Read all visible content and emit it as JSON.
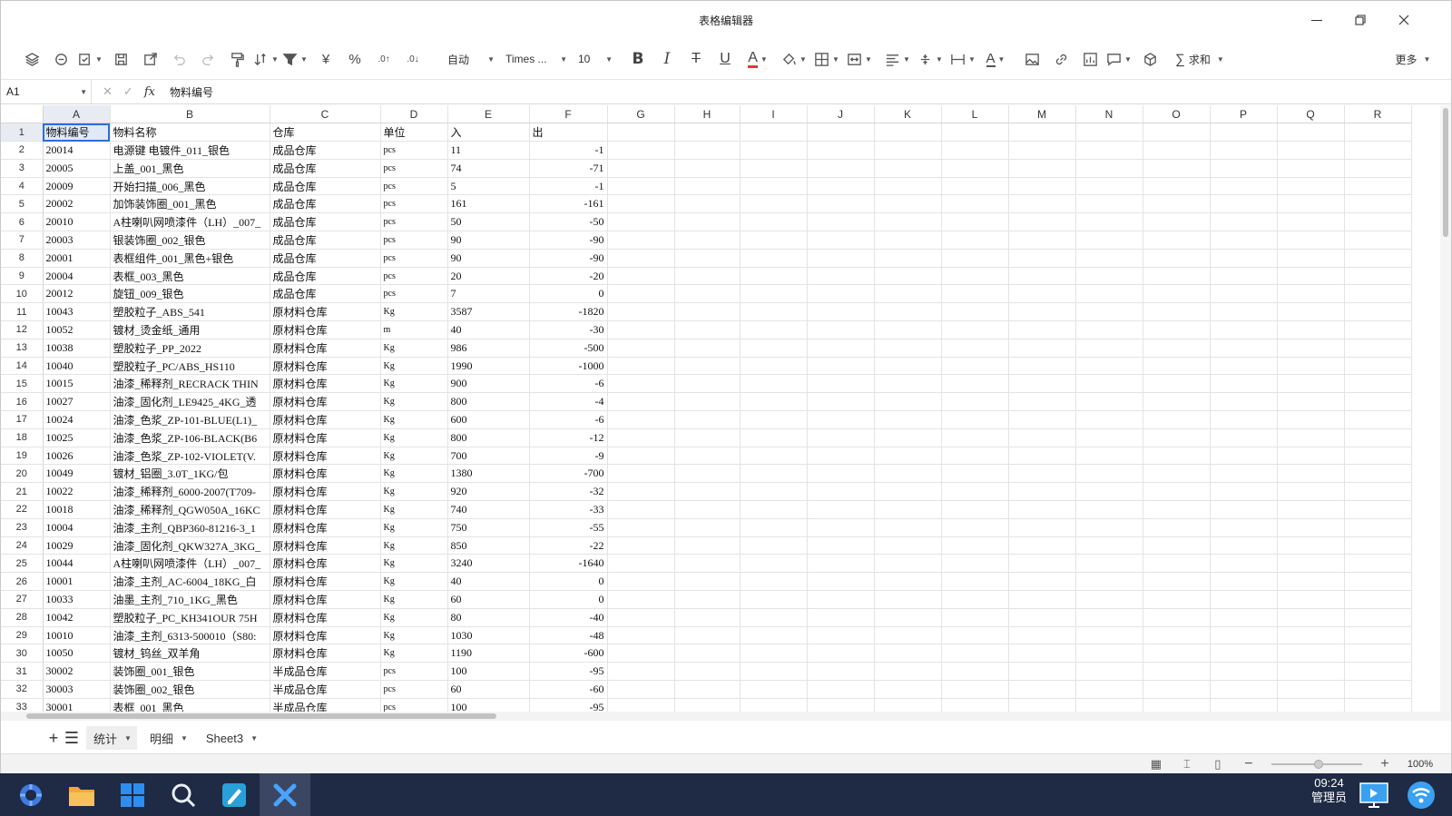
{
  "window": {
    "title": "表格编辑器"
  },
  "toolbar": {
    "font_format": "自动",
    "font_name": "Times ...",
    "font_size": "10",
    "sum_label": "求和",
    "more_label": "更多",
    "currency_symbol": "¥",
    "percent_symbol": "%",
    "bold_glyph": "B",
    "italic_glyph": "I",
    "underline_glyph": "U",
    "font_color_glyph": "A",
    "accent_color": "#e53935"
  },
  "formula_bar": {
    "cell_ref": "A1",
    "content": "物料编号",
    "fx_label": "fx"
  },
  "grid": {
    "columns": [
      "A",
      "B",
      "C",
      "D",
      "E",
      "F",
      "G",
      "H",
      "I",
      "J",
      "K",
      "L",
      "M",
      "N",
      "O",
      "P",
      "Q",
      "R"
    ],
    "rows": [
      {
        "n": "1",
        "a": "物料编号",
        "b": "物料名称",
        "c": "仓库",
        "d": "单位",
        "e": "入",
        "f": "出"
      },
      {
        "n": "2",
        "a": "20014",
        "b": "电源键 电镀件_011_银色",
        "c": "成品仓库",
        "d": "pcs",
        "e": "11",
        "f": "-1"
      },
      {
        "n": "3",
        "a": "20005",
        "b": "上盖_001_黑色",
        "c": "成品仓库",
        "d": "pcs",
        "e": "74",
        "f": "-71"
      },
      {
        "n": "4",
        "a": "20009",
        "b": "开始扫描_006_黑色",
        "c": "成品仓库",
        "d": "pcs",
        "e": "5",
        "f": "-1"
      },
      {
        "n": "5",
        "a": "20002",
        "b": "加饰装饰圈_001_黑色",
        "c": "成品仓库",
        "d": "pcs",
        "e": "161",
        "f": "-161"
      },
      {
        "n": "6",
        "a": "20010",
        "b": "A柱喇叭网喷漆件（LH）_007_",
        "c": "成品仓库",
        "d": "pcs",
        "e": "50",
        "f": "-50"
      },
      {
        "n": "7",
        "a": "20003",
        "b": "银装饰圈_002_银色",
        "c": "成品仓库",
        "d": "pcs",
        "e": "90",
        "f": "-90"
      },
      {
        "n": "8",
        "a": "20001",
        "b": "表框组件_001_黑色+银色",
        "c": "成品仓库",
        "d": "pcs",
        "e": "90",
        "f": "-90"
      },
      {
        "n": "9",
        "a": "20004",
        "b": "表框_003_黑色",
        "c": "成品仓库",
        "d": "pcs",
        "e": "20",
        "f": "-20"
      },
      {
        "n": "10",
        "a": "20012",
        "b": "旋钮_009_银色",
        "c": "成品仓库",
        "d": "pcs",
        "e": "7",
        "f": "0"
      },
      {
        "n": "11",
        "a": "10043",
        "b": "塑胶粒子_ABS_541",
        "c": "原材料仓库",
        "d": "Kg",
        "e": "3587",
        "f": "-1820"
      },
      {
        "n": "12",
        "a": "10052",
        "b": "镀材_烫金纸_通用",
        "c": "原材料仓库",
        "d": "m",
        "e": "40",
        "f": "-30"
      },
      {
        "n": "13",
        "a": "10038",
        "b": "塑胶粒子_PP_2022",
        "c": "原材料仓库",
        "d": "Kg",
        "e": "986",
        "f": "-500"
      },
      {
        "n": "14",
        "a": "10040",
        "b": "塑胶粒子_PC/ABS_HS110",
        "c": "原材料仓库",
        "d": "Kg",
        "e": "1990",
        "f": "-1000"
      },
      {
        "n": "15",
        "a": "10015",
        "b": "油漆_稀释剂_RECRACK THIN",
        "c": "原材料仓库",
        "d": "Kg",
        "e": "900",
        "f": "-6"
      },
      {
        "n": "16",
        "a": "10027",
        "b": "油漆_固化剂_LE9425_4KG_透",
        "c": "原材料仓库",
        "d": "Kg",
        "e": "800",
        "f": "-4"
      },
      {
        "n": "17",
        "a": "10024",
        "b": "油漆_色浆_ZP-101-BLUE(L1)_",
        "c": "原材料仓库",
        "d": "Kg",
        "e": "600",
        "f": "-6"
      },
      {
        "n": "18",
        "a": "10025",
        "b": "油漆_色浆_ZP-106-BLACK(B6",
        "c": "原材料仓库",
        "d": "Kg",
        "e": "800",
        "f": "-12"
      },
      {
        "n": "19",
        "a": "10026",
        "b": "油漆_色浆_ZP-102-VIOLET(V.",
        "c": "原材料仓库",
        "d": "Kg",
        "e": "700",
        "f": "-9"
      },
      {
        "n": "20",
        "a": "10049",
        "b": "镀材_铝圈_3.0T_1KG/包",
        "c": "原材料仓库",
        "d": "Kg",
        "e": "1380",
        "f": "-700"
      },
      {
        "n": "21",
        "a": "10022",
        "b": "油漆_稀释剂_6000-2007(T709-",
        "c": "原材料仓库",
        "d": "Kg",
        "e": "920",
        "f": "-32"
      },
      {
        "n": "22",
        "a": "10018",
        "b": "油漆_稀释剂_QGW050A_16KC",
        "c": "原材料仓库",
        "d": "Kg",
        "e": "740",
        "f": "-33"
      },
      {
        "n": "23",
        "a": "10004",
        "b": "油漆_主剂_QBP360-81216-3_1",
        "c": "原材料仓库",
        "d": "Kg",
        "e": "750",
        "f": "-55"
      },
      {
        "n": "24",
        "a": "10029",
        "b": "油漆_固化剂_QKW327A_3KG_",
        "c": "原材料仓库",
        "d": "Kg",
        "e": "850",
        "f": "-22"
      },
      {
        "n": "25",
        "a": "10044",
        "b": "A柱喇叭网喷漆件（LH）_007_",
        "c": "原材料仓库",
        "d": "Kg",
        "e": "3240",
        "f": "-1640"
      },
      {
        "n": "26",
        "a": "10001",
        "b": "油漆_主剂_AC-6004_18KG_白",
        "c": "原材料仓库",
        "d": "Kg",
        "e": "40",
        "f": "0"
      },
      {
        "n": "27",
        "a": "10033",
        "b": "油墨_主剂_710_1KG_黑色",
        "c": "原材料仓库",
        "d": "Kg",
        "e": "60",
        "f": "0"
      },
      {
        "n": "28",
        "a": "10042",
        "b": "塑胶粒子_PC_KH341OUR 75H",
        "c": "原材料仓库",
        "d": "Kg",
        "e": "80",
        "f": "-40"
      },
      {
        "n": "29",
        "a": "10010",
        "b": "油漆_主剂_6313-500010（S80:",
        "c": "原材料仓库",
        "d": "Kg",
        "e": "1030",
        "f": "-48"
      },
      {
        "n": "30",
        "a": "10050",
        "b": "镀材_钨丝_双羊角",
        "c": "原材料仓库",
        "d": "Kg",
        "e": "1190",
        "f": "-600"
      },
      {
        "n": "31",
        "a": "30002",
        "b": "装饰圈_001_银色",
        "c": "半成品仓库",
        "d": "pcs",
        "e": "100",
        "f": "-95"
      },
      {
        "n": "32",
        "a": "30003",
        "b": "装饰圈_002_银色",
        "c": "半成品仓库",
        "d": "pcs",
        "e": "60",
        "f": "-60"
      },
      {
        "n": "33",
        "a": "30001",
        "b": "表框_001_黑色",
        "c": "半成品仓库",
        "d": "pcs",
        "e": "100",
        "f": "-95"
      }
    ]
  },
  "sheets": [
    {
      "label": "统计",
      "active": true
    },
    {
      "label": "明细",
      "active": false
    },
    {
      "label": "Sheet3",
      "active": false
    }
  ],
  "status": {
    "zoom": "100%"
  },
  "taskbar": {
    "time": "09:24",
    "user": "管理员"
  }
}
